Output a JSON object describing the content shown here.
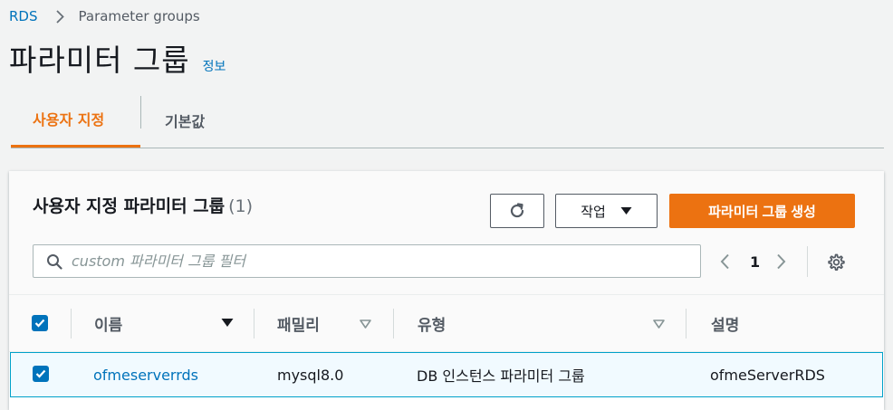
{
  "breadcrumb": {
    "root": "RDS",
    "current": "Parameter groups"
  },
  "page": {
    "title": "파라미터 그룹",
    "info": "정보"
  },
  "tabs": [
    {
      "label": "사용자 지정",
      "active": true
    },
    {
      "label": "기본값",
      "active": false
    }
  ],
  "panel": {
    "title": "사용자 지정 파라미터 그룹",
    "count": "(1)",
    "actions_label": "작업",
    "create_label": "파라미터 그룹 생성",
    "search_placeholder": "custom 파라미터 그룹 필터",
    "page_number": "1"
  },
  "table": {
    "columns": [
      "이름",
      "패밀리",
      "유형",
      "설명"
    ],
    "rows": [
      {
        "selected": true,
        "name": "ofmeserverrds",
        "family": "mysql8.0",
        "type": "DB 인스턴스 파라미터 그룹",
        "description": "ofmeServerRDS"
      }
    ]
  },
  "colors": {
    "accent": "#ec7211",
    "link": "#0073bb",
    "selected_row": "#f1faff"
  },
  "icons": [
    "chevron-right-icon",
    "refresh-icon",
    "caret-down-icon",
    "search-icon",
    "chevron-left-icon",
    "settings-gear-icon",
    "sort-desc-icon",
    "sort-icon",
    "check-icon"
  ]
}
